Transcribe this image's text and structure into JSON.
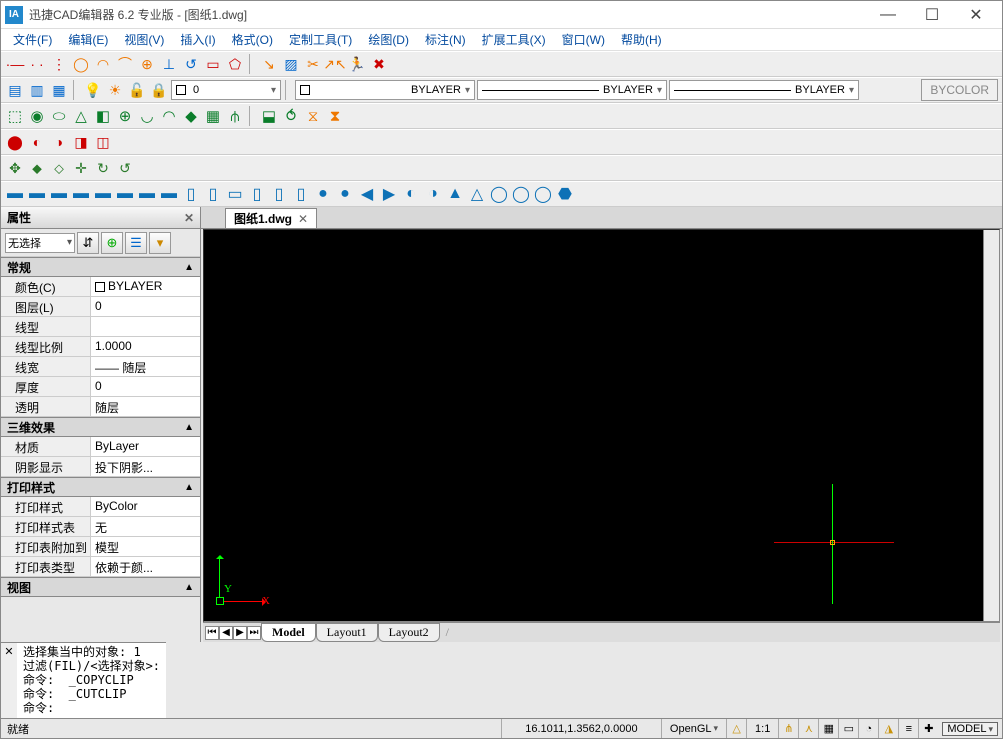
{
  "title": "迅捷CAD编辑器 6.2 专业版  -  [图纸1.dwg]",
  "menus": [
    "文件(F)",
    "编辑(E)",
    "视图(V)",
    "插入(I)",
    "格式(O)",
    "定制工具(T)",
    "绘图(D)",
    "标注(N)",
    "扩展工具(X)",
    "窗口(W)",
    "帮助(H)"
  ],
  "layer": {
    "current": "0",
    "color_text": "BYLAYER",
    "linetype_text": "BYLAYER",
    "lineweight_text": "BYLAYER",
    "bycolor_btn": "BYCOLOR"
  },
  "doc_tab": {
    "name": "图纸1.dwg"
  },
  "sidebar": {
    "title": "属性",
    "no_select": "无选择",
    "sections": {
      "general": "常规",
      "gen_rows": [
        {
          "k": "颜色(C)",
          "v": "BYLAYER",
          "swatch": true
        },
        {
          "k": "图层(L)",
          "v": "0"
        },
        {
          "k": "线型",
          "v": ""
        },
        {
          "k": "线型比例",
          "v": "1.0000"
        },
        {
          "k": "线宽",
          "v": "—— 随层"
        },
        {
          "k": "厚度",
          "v": "0"
        },
        {
          "k": "透明",
          "v": "随层"
        }
      ],
      "threeD": "三维效果",
      "threeD_rows": [
        {
          "k": "材质",
          "v": "ByLayer"
        },
        {
          "k": "阴影显示",
          "v": "投下阴影..."
        }
      ],
      "print": "打印样式",
      "print_rows": [
        {
          "k": "打印样式",
          "v": "ByColor"
        },
        {
          "k": "打印样式表",
          "v": "无"
        },
        {
          "k": "打印表附加到",
          "v": "模型"
        },
        {
          "k": "打印表类型",
          "v": "依赖于颜..."
        }
      ],
      "view": "视图"
    }
  },
  "model_tabs": [
    "Model",
    "Layout1",
    "Layout2"
  ],
  "console_lines": "选择集当中的对象: 1\n过滤(FIL)/<选择对象>:\n命令:  _COPYCLIP\n命令:  _CUTCLIP\n命令: ",
  "status": {
    "ready": "就绪",
    "coords": "16.1011,1.3562,0.0000",
    "gl": "OpenGL",
    "ratio": "1:1",
    "model": "MODEL"
  },
  "axis": {
    "x": "X",
    "y": "Y"
  }
}
